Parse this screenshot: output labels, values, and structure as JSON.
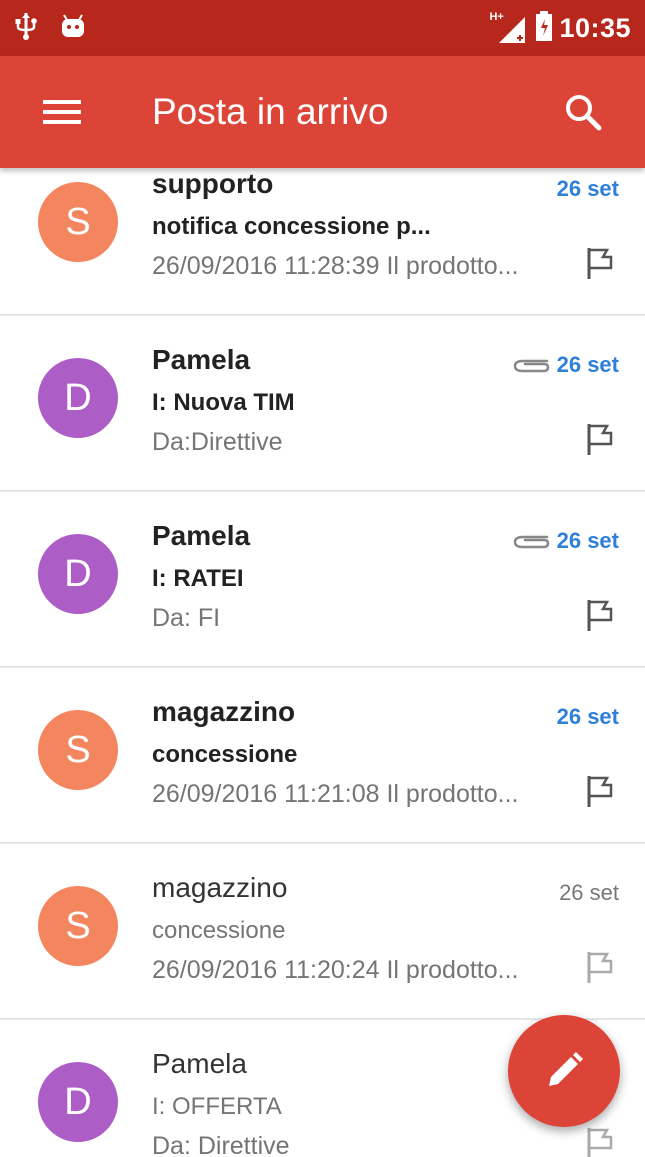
{
  "status_bar": {
    "icons": [
      "usb-icon",
      "android-icon",
      "signal-icon",
      "battery-icon"
    ],
    "network_label": "H+",
    "time": "10:35"
  },
  "app_bar": {
    "title": "Posta in arrivo",
    "menu_icon": "hamburger-menu-icon",
    "search_icon": "search-icon"
  },
  "colors": {
    "status_bar": "#b8271c",
    "app_bar": "#db4437",
    "unread_date": "#2f7fdc",
    "avatar_orange": "#f4865f",
    "avatar_purple": "#ad5ec6"
  },
  "messages": [
    {
      "initial": "S",
      "sender": "supporto",
      "subject": "notifica concessione p...",
      "snippet": "26/09/2016 11:28:39 Il prodotto...",
      "date": "26 set",
      "unread": true,
      "attachment": false,
      "avatar_color": "#f4865f"
    },
    {
      "initial": "D",
      "sender": "Pamela",
      "subject": "I: Nuova TIM",
      "snippet": "Da:Direttive",
      "date": "26 set",
      "unread": true,
      "attachment": true,
      "avatar_color": "#ad5ec6"
    },
    {
      "initial": "D",
      "sender": "Pamela",
      "subject": "I: RATEI",
      "snippet": "Da: FI",
      "date": "26 set",
      "unread": true,
      "attachment": true,
      "avatar_color": "#ad5ec6"
    },
    {
      "initial": "S",
      "sender": "magazzino",
      "subject": "concessione",
      "snippet": "26/09/2016 11:21:08 Il prodotto...",
      "date": "26 set",
      "unread": true,
      "attachment": false,
      "avatar_color": "#f4865f"
    },
    {
      "initial": "S",
      "sender": "magazzino",
      "subject": "concessione",
      "snippet": "26/09/2016 11:20:24 Il prodotto...",
      "date": "26 set",
      "unread": false,
      "attachment": false,
      "avatar_color": "#f4865f"
    },
    {
      "initial": "D",
      "sender": "Pamela",
      "subject": "I: OFFERTA",
      "snippet": "Da: Direttive",
      "date": "",
      "unread": false,
      "attachment": false,
      "avatar_color": "#ad5ec6"
    }
  ],
  "fab": {
    "icon": "pencil-compose-icon"
  }
}
